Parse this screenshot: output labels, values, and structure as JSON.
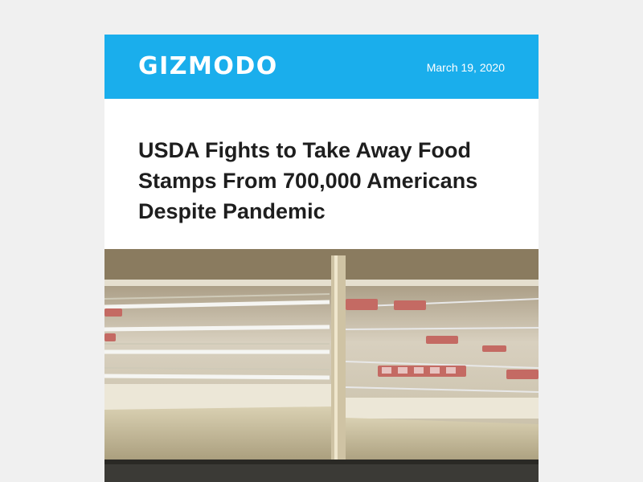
{
  "masthead": {
    "brand": "GIZMODO",
    "date": "March 19, 2020",
    "color": "#1aaeec"
  },
  "article": {
    "headline": "USDA Fights to Take Away Food Stamps From 700,000 Americans Despite Pandemic"
  },
  "hero_image": {
    "subject": "empty-grocery-refrigerated-shelves"
  }
}
